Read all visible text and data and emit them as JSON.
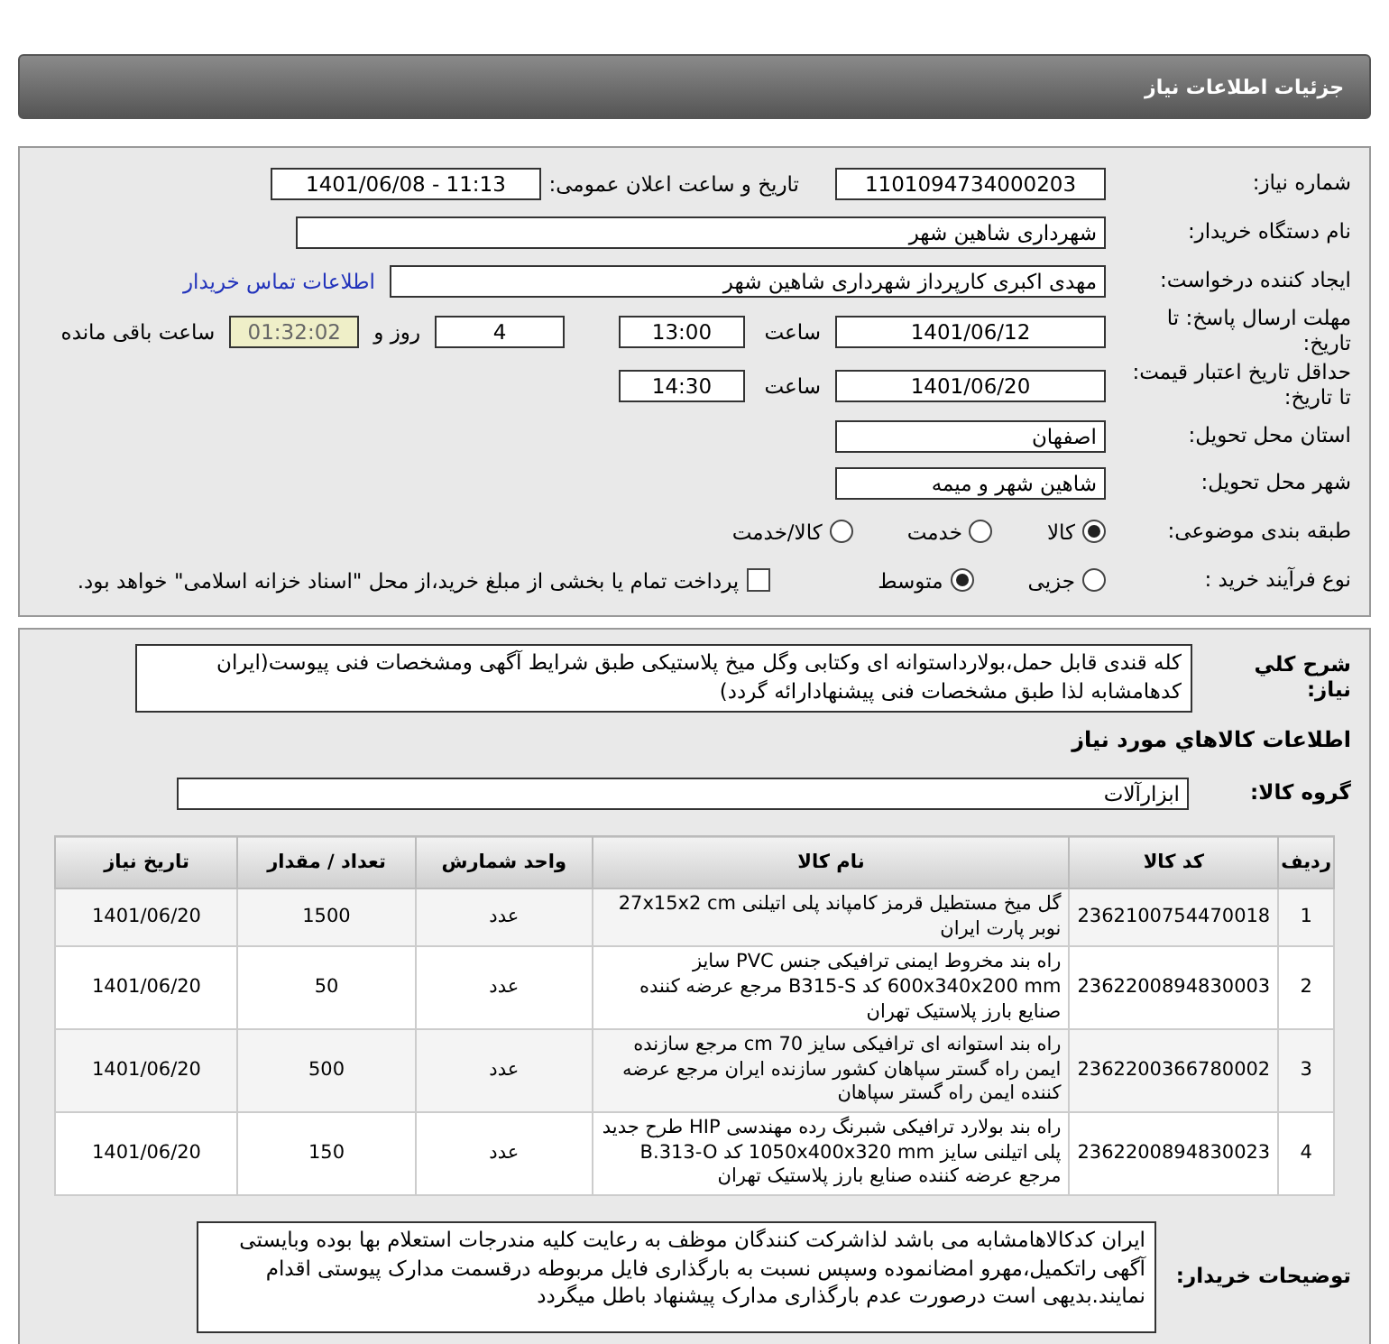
{
  "page_title": "جزئیات اطلاعات نیاز",
  "need_number": {
    "label": "شماره نیاز:",
    "value": "1101094734000203"
  },
  "announce": {
    "label": "تاریخ و ساعت اعلان عمومی:",
    "value": "1401/06/08 - 11:13"
  },
  "buyer_org": {
    "label": "نام دستگاه خریدار:",
    "value": "شهرداری شاهین شهر"
  },
  "requester": {
    "label": "ایجاد کننده درخواست:",
    "value": "مهدی اکبری کارپرداز شهرداری شاهین شهر",
    "link": "اطلاعات تماس خریدار"
  },
  "deadline": {
    "label": "مهلت ارسال پاسخ: تا تاریخ:",
    "date": "1401/06/12",
    "time_label": "ساعت",
    "time": "13:00",
    "days": "4",
    "days_label": "روز و",
    "remaining": "01:32:02",
    "remaining_label": "ساعت باقی مانده"
  },
  "validity": {
    "label": "حداقل تاریخ اعتبار قیمت: تا تاریخ:",
    "date": "1401/06/20",
    "time_label": "ساعت",
    "time": "14:30"
  },
  "province": {
    "label": "استان محل تحویل:",
    "value": "اصفهان"
  },
  "city": {
    "label": "شهر محل تحویل:",
    "value": "شاهین شهر و میمه"
  },
  "category": {
    "label": "طبقه بندی موضوعی:",
    "options": [
      {
        "label": "کالا",
        "selected": true
      },
      {
        "label": "خدمت",
        "selected": false
      },
      {
        "label": "کالا/خدمت",
        "selected": false
      }
    ]
  },
  "process": {
    "label": "نوع فرآیند خرید :",
    "options": [
      {
        "label": "جزیی",
        "selected": false
      },
      {
        "label": "متوسط",
        "selected": true
      }
    ],
    "payment": {
      "checked": false,
      "text": "پرداخت تمام یا بخشی از مبلغ خرید،از محل \"اسناد خزانه اسلامی\" خواهد بود."
    }
  },
  "description": {
    "label": "شرح کلي نیاز:",
    "text": "کله قندی قابل حمل،بولارداستوانه ای وکتابی وگل میخ پلاستیکی طبق شرایط آگهی ومشخصات فنی پیوست(ایران کدهامشابه لذا طبق مشخصات فنی پیشنهادارائه گردد)"
  },
  "goods_heading": "اطلاعات کالاهاي مورد نیاز",
  "goods_group": {
    "label": "گروه کالا:",
    "value": "ابزارآلات"
  },
  "table": {
    "columns": [
      "ردیف",
      "کد کالا",
      "نام کالا",
      "واحد شمارش",
      "تعداد / مقدار",
      "تاریخ نیاز"
    ],
    "rows": [
      [
        "1",
        "2362100754470018",
        "گل میخ مستطیل قرمز کامپاند پلی اتیلنی 27x15x2 cm نوبر پارت ایران",
        "عدد",
        "1500",
        "1401/06/20"
      ],
      [
        "2",
        "2362200894830003",
        "راه بند مخروط ایمنی ترافیکی جنس PVC سایز 600x340x200 mm کد B315-S مرجع عرضه کننده صنایع بارز پلاستیک تهران",
        "عدد",
        "50",
        "1401/06/20"
      ],
      [
        "3",
        "2362200366780002",
        "راه بند استوانه ای ترافیکی سایز 70 cm مرجع سازنده ایمن راه گستر سپاهان کشور سازنده ایران مرجع عرضه کننده ایمن راه گستر سپاهان",
        "عدد",
        "500",
        "1401/06/20"
      ],
      [
        "4",
        "2362200894830023",
        "راه بند بولارد ترافیکی شبرنگ رده مهندسی HIP طرح جدید پلی اتیلنی سایز 1050x400x320 mm کد B.313-O مرجع عرضه کننده صنایع بارز پلاستیک تهران",
        "عدد",
        "150",
        "1401/06/20"
      ]
    ]
  },
  "buyer_notes": {
    "label": "توضیحات خریدار:",
    "text": "ایران کدکالاهامشابه می باشد لذاشرکت کنندگان موظف به رعایت کلیه مندرجات استعلام بها بوده وبایستی آگهی راتکمیل،مهرو امضانموده وسپس نسبت به بارگذاری فایل مربوطه درقسمت مدارک پیوستی اقدام نمایند.بدیهی است درصورت عدم بارگذاری مدارک پیشنهاد باطل میگردد"
  }
}
